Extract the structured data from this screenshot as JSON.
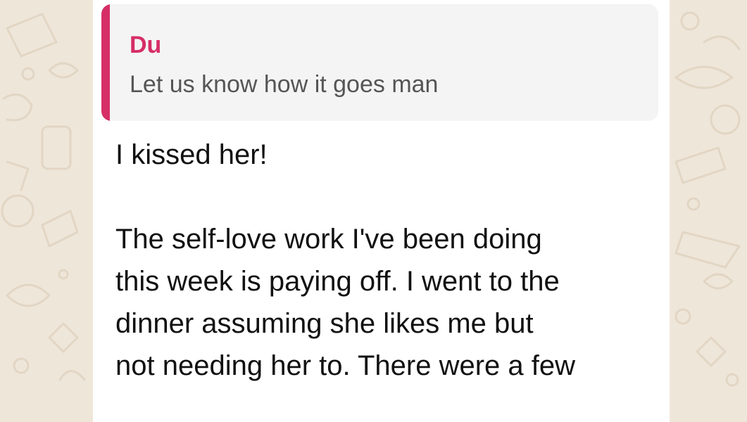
{
  "quote": {
    "author": "Du",
    "text": "Let us know how it goes man"
  },
  "message": {
    "first_line": "I kissed her!",
    "lines": [
      "The self-love work I've been doing",
      "this week is paying off. I went to the",
      "dinner assuming she likes me but",
      "not needing her to. There were a few"
    ]
  },
  "colors": {
    "wallpaper": "#efe6da",
    "bubble": "#ffffff",
    "quote_background": "#f4f4f4",
    "quote_accent": "#d62e66"
  }
}
